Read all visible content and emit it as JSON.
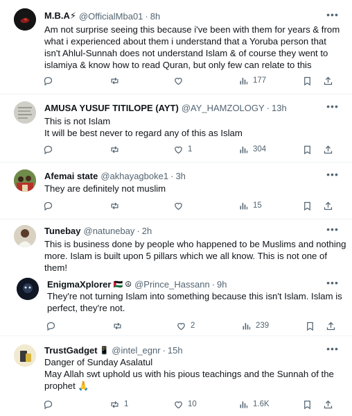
{
  "tweets": [
    {
      "name": "M.B.A⚡",
      "handle": "@OfficialMba01",
      "time": "8h",
      "lines": [
        "Am not surprise seeing this because i've been with them for years & from",
        "what i experienced about them i understand that a Yoruba person that",
        "isn't Ahlul-Sunnah does not understand Islam & of course they went to",
        "islamiya & know how to read Quran, but only few can relate to this"
      ],
      "reposts": "",
      "likes": "",
      "views": "177"
    },
    {
      "name": "AMUSA YUSUF TITILOPE (AYT)",
      "handle": "@AY_HAMZOLOGY",
      "time": "13h",
      "lines": [
        "This is not Islam",
        "It will be best never to regard any of this as Islam"
      ],
      "reposts": "",
      "likes": "1",
      "views": "304"
    },
    {
      "name": "Afemai state",
      "handle": "@akhayagboke1",
      "time": "3h",
      "lines": [
        "They are definitely not muslim"
      ],
      "reposts": "",
      "likes": "",
      "views": "15"
    },
    {
      "name": "Tunebay",
      "handle": "@natunebay",
      "time": "2h",
      "lines": [
        "This is business done by people who happened to be Muslims and nothing",
        "more. Islam is built upon 5 pillars which we all know. This is not one of",
        "them!"
      ],
      "reposts": "",
      "likes": "",
      "views": ""
    },
    {
      "name": "EnigmaXplorer",
      "name_emoji": "🇵🇸 ☮",
      "handle": "@Prince_Hassann",
      "time": "9h",
      "lines": [
        "They're not turning Islam into something because this isn't Islam. Islam is",
        "perfect, they're not."
      ],
      "reposts": "",
      "likes": "2",
      "views": "239"
    },
    {
      "name": "TrustGadget",
      "name_emoji": "📱",
      "handle": "@intel_egnr",
      "time": "15h",
      "lines": [
        "Danger of Sunday Asalatul",
        "May Allah swt uphold us with his pious teachings and the Sunnah of the",
        "prophet 🙏"
      ],
      "reposts": "1",
      "likes": "10",
      "views": "1.6K"
    }
  ],
  "separator": "·",
  "icons": {
    "reply": "reply-bubble-icon",
    "repost": "repost-arrows-icon",
    "like": "heart-icon",
    "views": "analytics-bars-icon",
    "bookmark": "bookmark-icon",
    "share": "share-upload-icon",
    "more": "more-dots-icon"
  },
  "colors": {
    "text": "#0f1419",
    "secondary": "#536471",
    "divider": "#eff3f4"
  }
}
